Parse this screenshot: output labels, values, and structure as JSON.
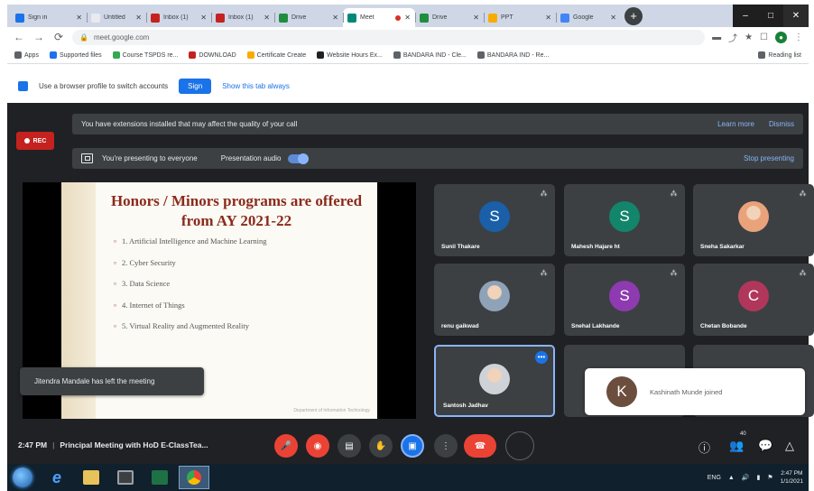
{
  "browser": {
    "tabs": [
      {
        "title": "Sign in",
        "color": "#1a73e8",
        "active": false
      },
      {
        "title": "Untitled",
        "color": "#e8eaed",
        "active": false
      },
      {
        "title": "Inbox (1)",
        "color": "#c5221f",
        "active": false
      },
      {
        "title": "Inbox (1)",
        "color": "#c5221f",
        "active": false
      },
      {
        "title": "Drive",
        "color": "#1e8e3e",
        "active": false
      },
      {
        "title": "Meet",
        "color": "#00897b",
        "active": true
      },
      {
        "title": "Drive",
        "color": "#1e8e3e",
        "active": false
      },
      {
        "title": "PPT",
        "color": "#f9ab00",
        "active": false
      },
      {
        "title": "Google",
        "color": "#4285f4",
        "active": false
      }
    ],
    "new_tab": "+",
    "window_controls": [
      "–",
      "□",
      "✕"
    ],
    "url": "meet.google.com",
    "bookmarks": [
      "Apps",
      "Supported files",
      "Course TSPDS re...",
      "DOWNLOAD",
      "Certificate Create",
      "Website Hours Ex...",
      "BANDARA IND - Cle...",
      "BANDARA IND - Re..."
    ],
    "bookmarks_more": "Reading list",
    "infobar": {
      "text": "Use a browser profile to switch accounts",
      "button": "Sign",
      "link": "Show this tab always"
    }
  },
  "meet": {
    "rec_label": "REC",
    "extension_banner": {
      "text": "You have extensions installed that may affect the quality of your call",
      "learn_more": "Learn more",
      "dismiss": "Dismiss"
    },
    "presenting_banner": {
      "text": "You're presenting to everyone",
      "audio_label": "Presentation audio",
      "audio_on": true,
      "stop": "Stop presenting"
    },
    "slide": {
      "title": "Honors / Minors programs are offered from AY 2021-22",
      "items": [
        "1. Artificial Intelligence and Machine Learning",
        "2. Cyber Security",
        "3. Data Science",
        "4. Internet of Things",
        "5. Virtual Reality and Augmented Reality"
      ],
      "footer": "Department of Information Technology"
    },
    "toast": "Jitendra Mandale has left the meeting",
    "participants": [
      {
        "name": "Sunil Thakare",
        "initial": "S",
        "color": "#1a5fa8",
        "photo": false
      },
      {
        "name": "Mahesh Hajare ht",
        "initial": "S",
        "color": "#12856b",
        "photo": false
      },
      {
        "name": "Sneha Sakarkar",
        "initial": "",
        "color": "#e9a27a",
        "photo": true
      },
      {
        "name": "renu gaikwad",
        "initial": "",
        "color": "#8ea3b8",
        "photo": true
      },
      {
        "name": "Snehal Lakhande",
        "initial": "S",
        "color": "#8e3ab0",
        "photo": false
      },
      {
        "name": "Chetan Bobande",
        "initial": "C",
        "color": "#b0375b",
        "photo": false
      },
      {
        "name": "Santosh Jadhav",
        "initial": "",
        "color": "#cfd3d8",
        "photo": true
      },
      {
        "name": "",
        "initial": "",
        "color": "#3c4043",
        "photo": false
      },
      {
        "name": "",
        "initial": "",
        "color": "#3c4043",
        "photo": false
      }
    ],
    "join_card": {
      "initial": "K",
      "text": "Kashinath Munde joined"
    },
    "meeting_time": "2:47 PM",
    "meeting_title": "Principal Meeting with HoD E-ClassTea...",
    "people_count": "40"
  },
  "taskbar": {
    "lang": "ENG",
    "time": "2:47 PM",
    "date": "1/1/2021"
  }
}
